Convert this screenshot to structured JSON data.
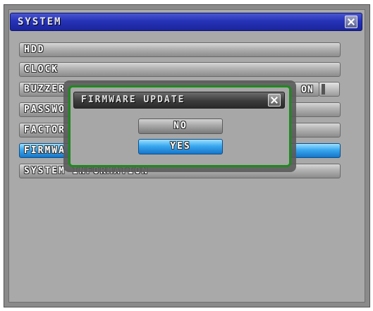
{
  "window": {
    "title": "SYSTEM",
    "close_icon": "close-icon",
    "accent_color": "#2633b8"
  },
  "menu": {
    "items": [
      {
        "label": "HDD",
        "selected": false
      },
      {
        "label": "CLOCK",
        "selected": false
      },
      {
        "label": "BUZZER",
        "selected": false,
        "value": "ON"
      },
      {
        "label": "PASSWO",
        "selected": false
      },
      {
        "label": "FACTOR",
        "selected": false
      },
      {
        "label": "FIRMWA",
        "selected": true
      },
      {
        "label": "SYSTEM  INFORMATION",
        "selected": false
      }
    ],
    "selected_color": "#3aa8f0"
  },
  "dialog": {
    "title": "FIRMWARE UPDATE",
    "close_icon": "close-icon",
    "border_color": "#1e8a1e",
    "no_label": "NO",
    "yes_label": "YES"
  }
}
